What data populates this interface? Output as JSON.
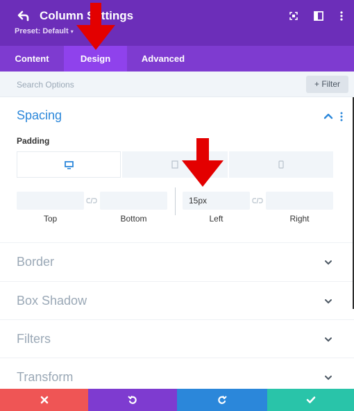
{
  "header": {
    "title": "Column Settings",
    "preset": "Preset: Default",
    "colors": {
      "header_bg": "#6c2eb9",
      "tabs_bg": "#7e3bd0",
      "active_tab": "#8f42ec"
    }
  },
  "tabs": [
    {
      "label": "Content",
      "active": false
    },
    {
      "label": "Design",
      "active": true
    },
    {
      "label": "Advanced",
      "active": false
    }
  ],
  "search": {
    "placeholder": "Search Options",
    "filter_label": "+ Filter"
  },
  "spacing": {
    "title": "Spacing",
    "padding_label": "Padding",
    "devices": [
      "desktop-icon",
      "tablet-icon",
      "phone-icon"
    ],
    "fields": [
      {
        "label": "Top",
        "value": ""
      },
      {
        "label": "Bottom",
        "value": ""
      },
      {
        "label": "Left",
        "value": "15px"
      },
      {
        "label": "Right",
        "value": ""
      }
    ]
  },
  "sections": [
    {
      "title": "Border"
    },
    {
      "title": "Box Shadow"
    },
    {
      "title": "Filters"
    },
    {
      "title": "Transform"
    }
  ],
  "footer": {
    "buttons": [
      {
        "name": "discard",
        "icon": "close-icon",
        "color": "#ef5555"
      },
      {
        "name": "undo",
        "icon": "undo-icon",
        "color": "#7e3bd0"
      },
      {
        "name": "redo",
        "icon": "redo-icon",
        "color": "#2b87da"
      },
      {
        "name": "save",
        "icon": "check-icon",
        "color": "#29c4a9"
      }
    ]
  },
  "annotation_color": "#e30000"
}
